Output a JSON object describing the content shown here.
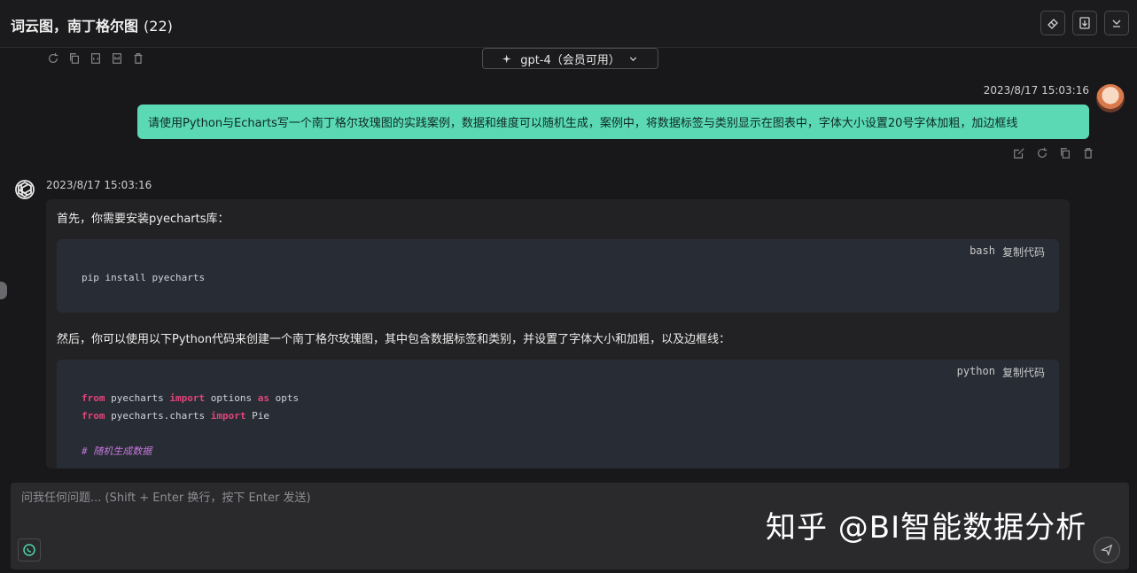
{
  "header": {
    "title": "词云图，南丁格尔图",
    "count": "(22)",
    "buttons": [
      "eraser-icon",
      "export-icon",
      "collapse-icon"
    ]
  },
  "toolbar": {
    "icons": [
      "refresh-icon",
      "copy-icon",
      "html-export-icon",
      "markdown-export-icon",
      "delete-icon"
    ]
  },
  "model": {
    "label": "gpt-4（会员可用）"
  },
  "user_message": {
    "time": "2023/8/17 15:03:16",
    "text": "请使用Python与Echarts写一个南丁格尔玫瑰图的实践案例，数据和维度可以随机生成，案例中，将数据标签与类别显示在图表中，字体大小设置20号字体加粗，加边框线"
  },
  "bot_message": {
    "time": "2023/8/17 15:03:16",
    "para1": "首先，你需要安装pyecharts库：",
    "code1": {
      "lang": "bash",
      "copy": "复制代码",
      "line1": "pip install pyecharts"
    },
    "para2": "然后，你可以使用以下Python代码来创建一个南丁格尔玫瑰图，其中包含数据标签和类别，并设置了字体大小和加粗，以及边框线：",
    "code2": {
      "lang": "python",
      "copy": "复制代码",
      "l1_kw1": "from",
      "l1_mod": " pyecharts ",
      "l1_kw2": "import",
      "l1_rest": " options ",
      "l1_kw3": "as",
      "l1_alias": " opts",
      "l2_kw1": "from",
      "l2_mod": " pyecharts.charts ",
      "l2_kw2": "import",
      "l2_rest": " Pie",
      "l3_comment": "# 随机生成数据"
    }
  },
  "input": {
    "placeholder": "问我任何问题... (Shift + Enter 换行，按下 Enter 发送)"
  },
  "watermark": "知乎 @BI智能数据分析",
  "colors": {
    "accent": "#5ad9b4",
    "background": "#18181a",
    "code_bg": "#282c34",
    "keyword": "#e0457b"
  }
}
